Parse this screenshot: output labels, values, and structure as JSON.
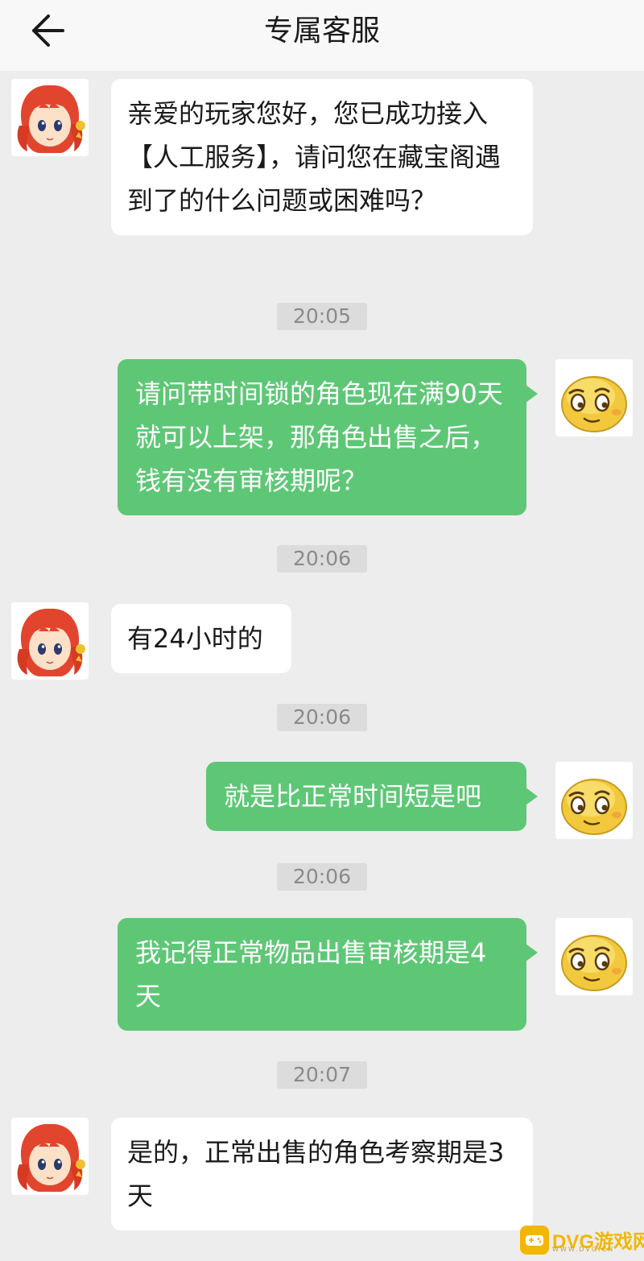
{
  "header": {
    "title": "专属客服",
    "back_icon": "arrow-left-icon"
  },
  "messages": [
    {
      "type": "incoming",
      "avatar": "agent-avatar-icon",
      "text": "亲爱的玩家您好，您已成功接入【人工服务】，请问您在藏宝阁遇到了的什么问题或困难吗？"
    },
    {
      "type": "time",
      "text": "20:05"
    },
    {
      "type": "outgoing",
      "avatar": "smiley-avatar-icon",
      "text": "请问带时间锁的角色现在满90天就可以上架，那角色出售之后，钱有没有审核期呢？"
    },
    {
      "type": "time",
      "text": "20:06"
    },
    {
      "type": "incoming",
      "avatar": "agent-avatar-icon",
      "text": "有24小时的"
    },
    {
      "type": "time",
      "text": "20:06"
    },
    {
      "type": "outgoing",
      "avatar": "smiley-avatar-icon",
      "text": "就是比正常时间短是吧"
    },
    {
      "type": "time",
      "text": "20:06"
    },
    {
      "type": "outgoing",
      "avatar": "smiley-avatar-icon",
      "text": "我记得正常物品出售审核期是4天"
    },
    {
      "type": "time",
      "text": "20:07"
    },
    {
      "type": "incoming",
      "avatar": "agent-avatar-icon",
      "text": "是的，正常出售的角色考察期是3天"
    }
  ],
  "watermark": {
    "text": "DVG游戏网",
    "sub": "WWW.DVG.CN"
  },
  "colors": {
    "outgoing_bubble": "#5ec776",
    "incoming_bubble": "#ffffff",
    "background": "#ededed",
    "header": "#f8f8f8"
  }
}
